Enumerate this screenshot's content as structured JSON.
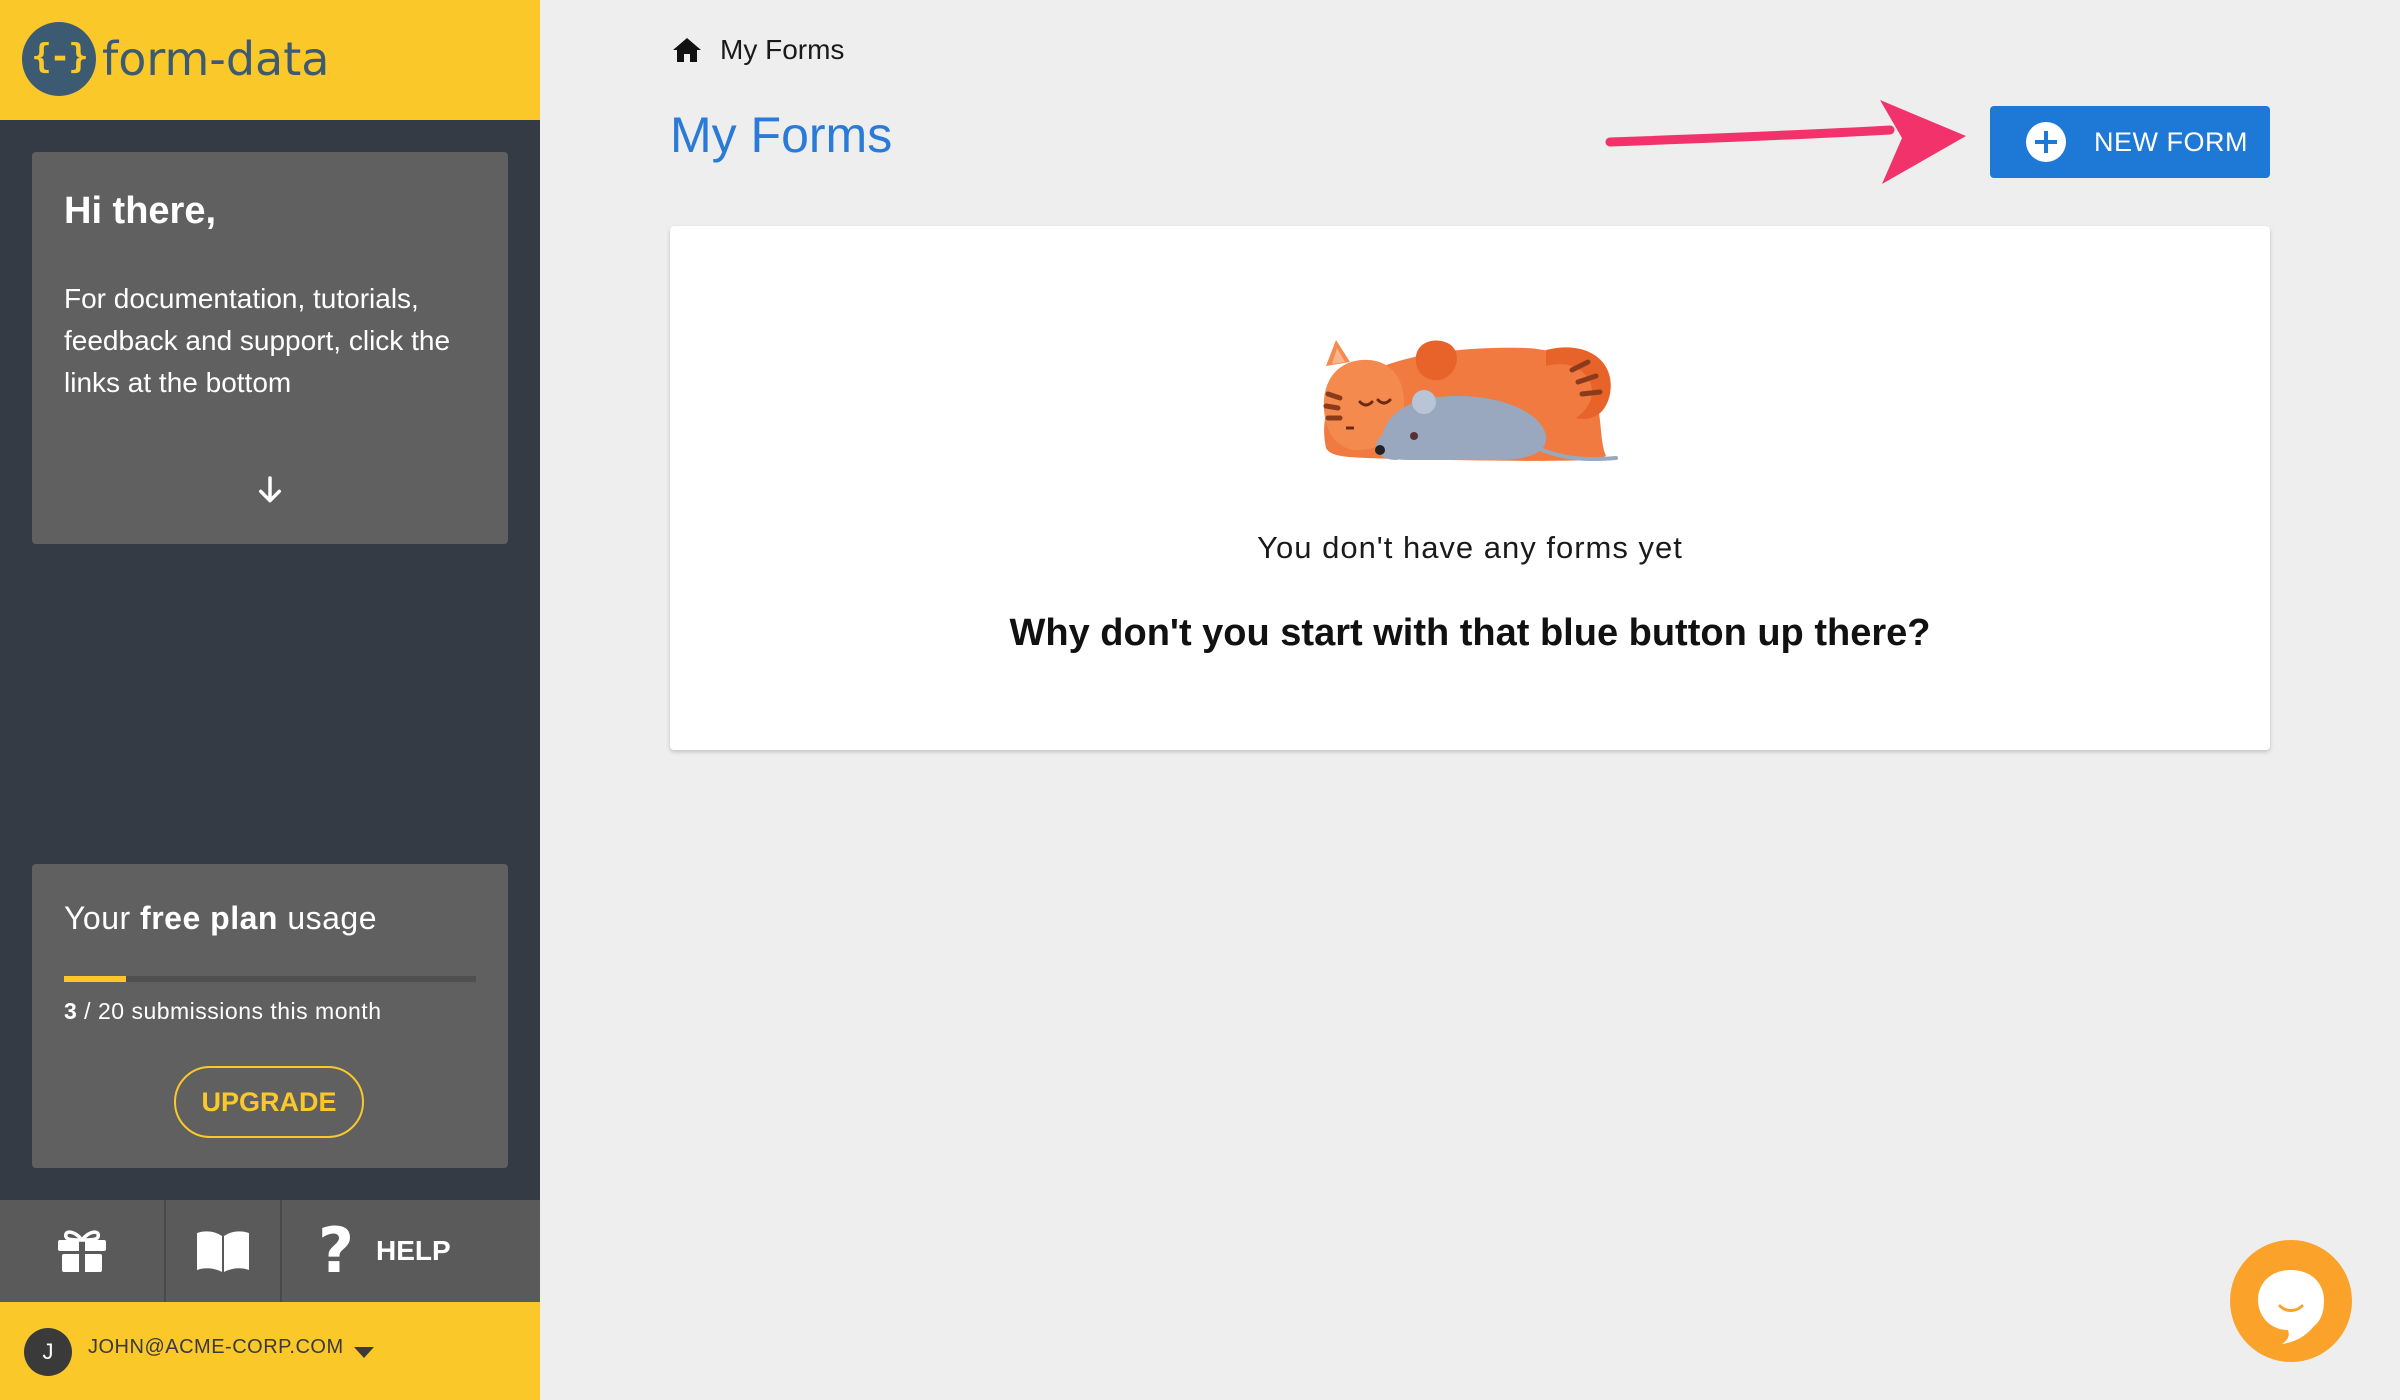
{
  "brand": {
    "logo_glyph": "{-}",
    "name": "form-data"
  },
  "sidebar": {
    "welcome": {
      "title": "Hi there,",
      "text": "For documentation, tutorials, feedback and support, click the links at the bottom",
      "arrow_icon": "arrow-down-icon"
    },
    "usage": {
      "title_prefix": "Your ",
      "title_bold": "free plan",
      "title_suffix": " usage",
      "used": "3",
      "separator": " / ",
      "rest": "20 submissions this month",
      "progress_fraction": 0.15,
      "upgrade_label": "UPGRADE"
    },
    "bottom_links": {
      "gift_icon": "gift-icon",
      "docs_icon": "book-icon",
      "help_glyph": "?",
      "help_label": "HELP"
    },
    "user": {
      "initial": "J",
      "email": "JOHN@ACME-CORP.COM"
    }
  },
  "main": {
    "breadcrumb": {
      "icon": "home-icon",
      "label": "My Forms"
    },
    "title": "My Forms",
    "new_form_label": "NEW FORM",
    "empty_state": {
      "message": "You don't have any forms yet",
      "cta": "Why don't you start with that blue button up there?"
    }
  },
  "colors": {
    "brand_yellow": "#fbc82a",
    "sidebar_bg": "#353b45",
    "primary_blue": "#1e78d6",
    "title_blue": "#2a7bd8",
    "arrow_pink": "#f2336b",
    "chat_orange": "#fba22a"
  }
}
